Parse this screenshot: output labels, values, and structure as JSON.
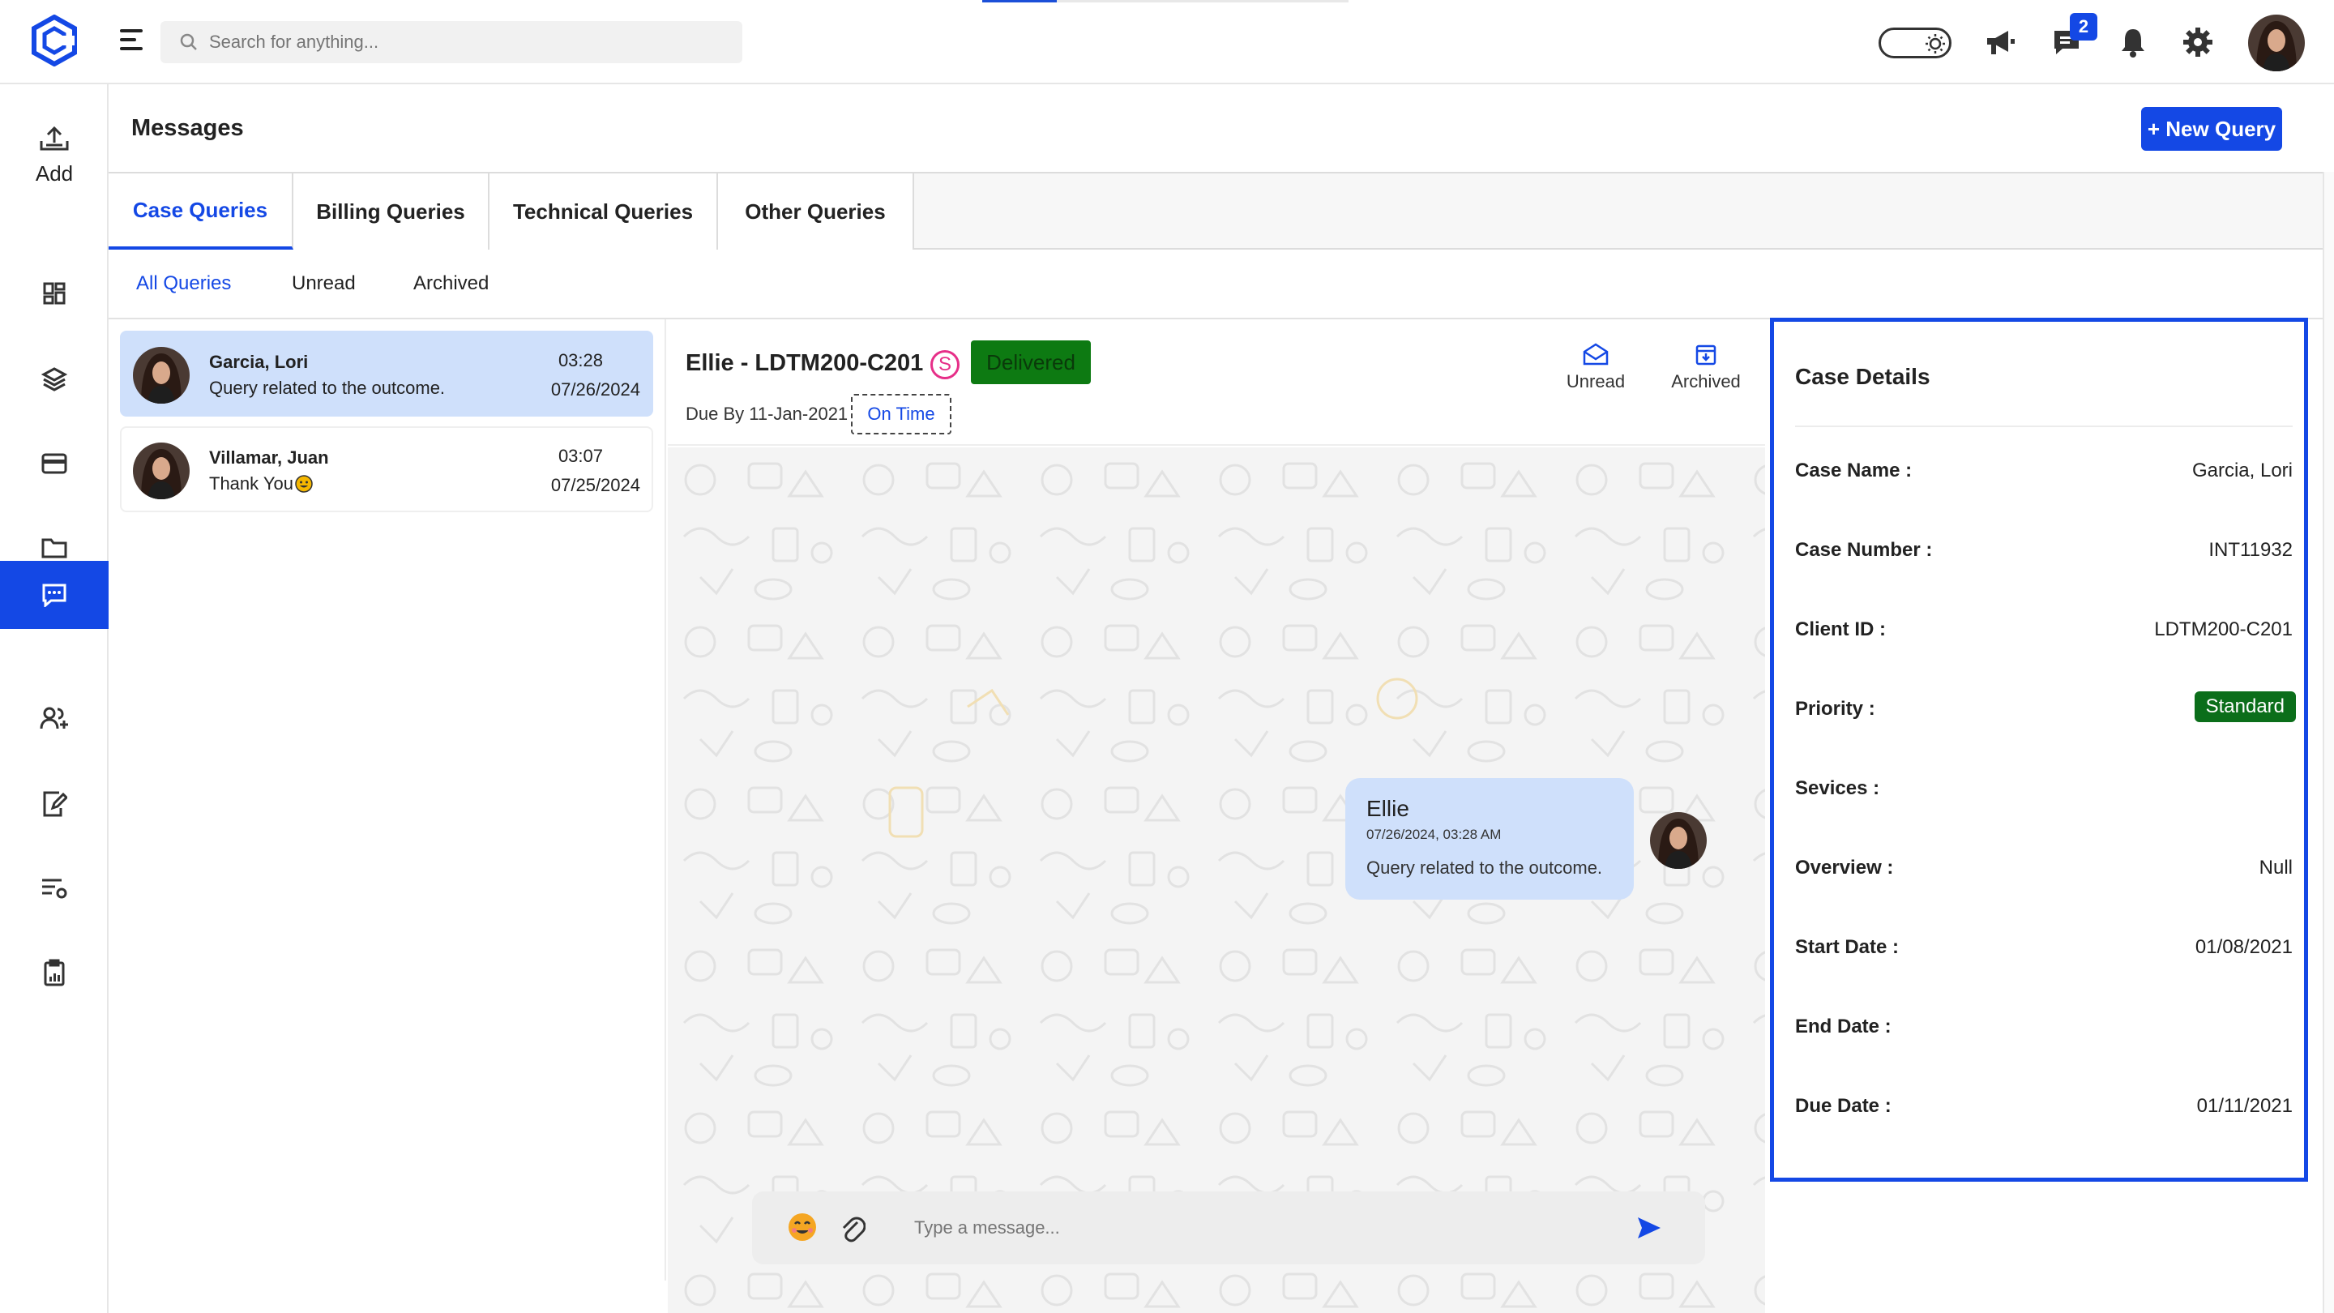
{
  "topbar": {
    "search_placeholder": "Search for anything...",
    "chat_badge_count": "2"
  },
  "sidebar": {
    "add_label": "Add",
    "items": [
      "dashboard-icon",
      "layers-icon",
      "billing-card-icon",
      "folder-icon",
      "messages-icon",
      "users-icon",
      "edit-doc-icon",
      "settings-list-icon",
      "clipboard-icon"
    ],
    "active_item": "messages-icon"
  },
  "page": {
    "title": "Messages",
    "new_query_label": "+ New Query"
  },
  "tabs": [
    {
      "label": "Case Queries",
      "active": true
    },
    {
      "label": "Billing Queries",
      "active": false
    },
    {
      "label": "Technical Queries",
      "active": false
    },
    {
      "label": "Other Queries",
      "active": false
    }
  ],
  "subtabs": [
    {
      "label": "All Queries",
      "active": true
    },
    {
      "label": "Unread",
      "active": false
    },
    {
      "label": "Archived",
      "active": false
    }
  ],
  "conversations": [
    {
      "name": "Garcia, Lori",
      "message": "Query related to the outcome.",
      "time": "03:28",
      "date": "07/26/2024",
      "selected": true
    },
    {
      "name": "Villamar, Juan",
      "message": "Thank You",
      "time": "03:07",
      "date": "07/25/2024",
      "selected": false
    }
  ],
  "chat": {
    "title": "Ellie - LDTM200-C201",
    "s_badge": "S",
    "status": "Delivered",
    "due_by": "Due By 11-Jan-2021",
    "on_time": "On Time",
    "action_unread": "Unread",
    "action_archived": "Archived",
    "message": {
      "sender": "Ellie",
      "timestamp": "07/26/2024, 03:28 AM",
      "text": "Query related to the outcome."
    },
    "composer_placeholder": "Type a message..."
  },
  "case_details": {
    "title": "Case Details",
    "rows": [
      {
        "label": "Case Name :",
        "value": "Garcia, Lori"
      },
      {
        "label": "Case Number :",
        "value": "INT11932"
      },
      {
        "label": "Client ID :",
        "value": "LDTM200-C201"
      },
      {
        "label": "Priority :",
        "value": "Standard"
      },
      {
        "label": "Sevices :",
        "value": ""
      },
      {
        "label": "Overview :",
        "value": "Null"
      },
      {
        "label": "Start Date :",
        "value": "01/08/2021"
      },
      {
        "label": "End Date :",
        "value": ""
      },
      {
        "label": "Due Date :",
        "value": "01/11/2021"
      }
    ]
  },
  "colors": {
    "accent": "#1448e5",
    "selected_row": "#cfe0fb",
    "delivered": "#0d7a12",
    "priority_pill": "#0b6e1a",
    "s_badge": "#e62f88"
  }
}
